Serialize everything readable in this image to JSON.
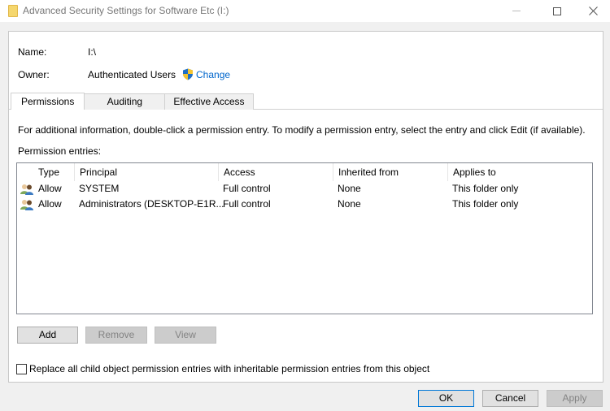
{
  "window": {
    "title": "Advanced Security Settings for Software Etc (I:)",
    "minimize_icon": "minimize-icon",
    "maximize_icon": "maximize-icon",
    "close_icon": "close-icon"
  },
  "info": {
    "name_label": "Name:",
    "name_value": "I:\\",
    "owner_label": "Owner:",
    "owner_value": "Authenticated Users",
    "change_link": "Change"
  },
  "tabs": [
    {
      "label": "Permissions",
      "active": true
    },
    {
      "label": "Auditing",
      "active": false
    },
    {
      "label": "Effective Access",
      "active": false
    }
  ],
  "permissions": {
    "instructions": "For additional information, double-click a permission entry. To modify a permission entry, select the entry and click Edit (if available).",
    "entries_label": "Permission entries:",
    "columns": [
      "Type",
      "Principal",
      "Access",
      "Inherited from",
      "Applies to"
    ],
    "rows": [
      {
        "type": "Allow",
        "principal": "SYSTEM",
        "access": "Full control",
        "inherited_from": "None",
        "applies_to": "This folder only"
      },
      {
        "type": "Allow",
        "principal": "Administrators (DESKTOP-E1R...",
        "access": "Full control",
        "inherited_from": "None",
        "applies_to": "This folder only"
      }
    ],
    "buttons": {
      "add": "Add",
      "remove": "Remove",
      "view": "View"
    },
    "replace_checkbox_label": "Replace all child object permission entries with inheritable permission entries from this object",
    "replace_checked": false
  },
  "footer": {
    "ok": "OK",
    "cancel": "Cancel",
    "apply": "Apply"
  }
}
